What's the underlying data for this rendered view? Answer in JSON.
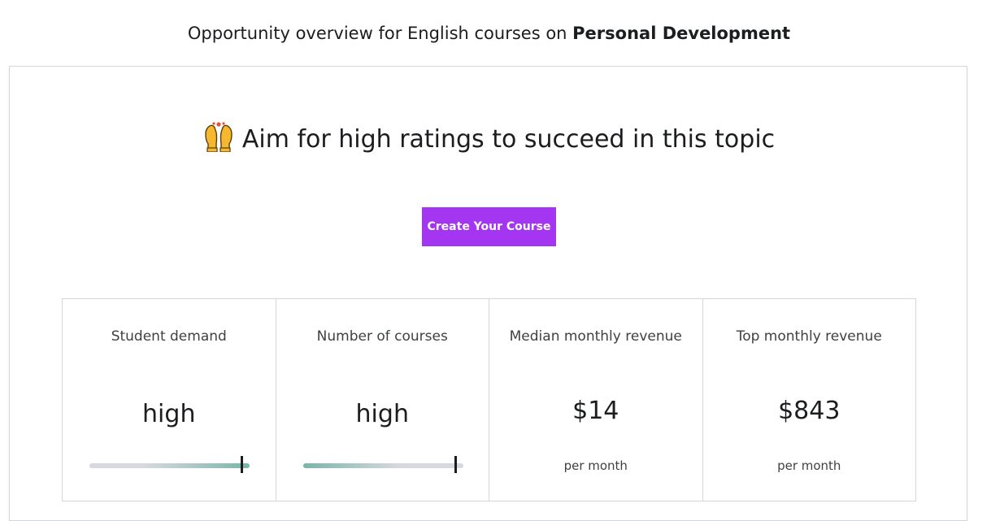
{
  "heading": {
    "prefix": "Opportunity overview for English courses on ",
    "topic": "Personal Development"
  },
  "headline": {
    "emoji_icon": "raising-hands-icon",
    "text": "Aim for high ratings to succeed in this topic"
  },
  "cta": {
    "label": "Create Your Course",
    "color": "#a435f0"
  },
  "metrics": [
    {
      "label": "Student demand",
      "value": "high",
      "gauge_level": 0.95
    },
    {
      "label": "Number of courses",
      "value": "high",
      "gauge_level": 0.95
    },
    {
      "label": "Median monthly revenue",
      "value": "$14",
      "sub": "per month"
    },
    {
      "label": "Top monthly revenue",
      "value": "$843",
      "sub": "per month"
    }
  ],
  "colors": {
    "accent": "#a435f0",
    "gauge_high": "#7ab4a8",
    "gauge_low": "#d6d9dd"
  }
}
